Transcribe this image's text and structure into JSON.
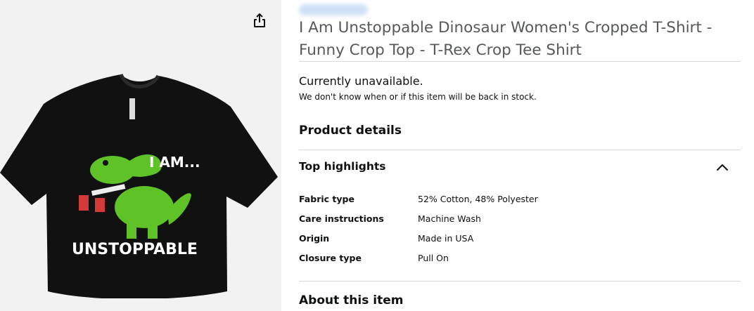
{
  "product": {
    "title": "I Am Unstoppable Dinosaur Women's Cropped T-Shirt - Funny Crop Top - T-Rex Crop Tee Shirt",
    "image_text_top": "I AM...",
    "image_text_bottom": "UNSTOPPABLE"
  },
  "availability": {
    "status": "Currently unavailable.",
    "detail": "We don't know when or if this item will be back in stock."
  },
  "sections": {
    "product_details": "Product details",
    "top_highlights": "Top highlights",
    "about": "About this item"
  },
  "details": [
    {
      "key": "Fabric type",
      "value": "52% Cotton, 48% Polyester"
    },
    {
      "key": "Care instructions",
      "value": "Machine Wash"
    },
    {
      "key": "Origin",
      "value": "Made in USA"
    },
    {
      "key": "Closure type",
      "value": "Pull On"
    }
  ],
  "icons": {
    "share": "share-icon",
    "collapse": "chevron-up-icon"
  },
  "colors": {
    "shirt": "#111111",
    "dino": "#5fc226",
    "title_text": "#565959"
  }
}
